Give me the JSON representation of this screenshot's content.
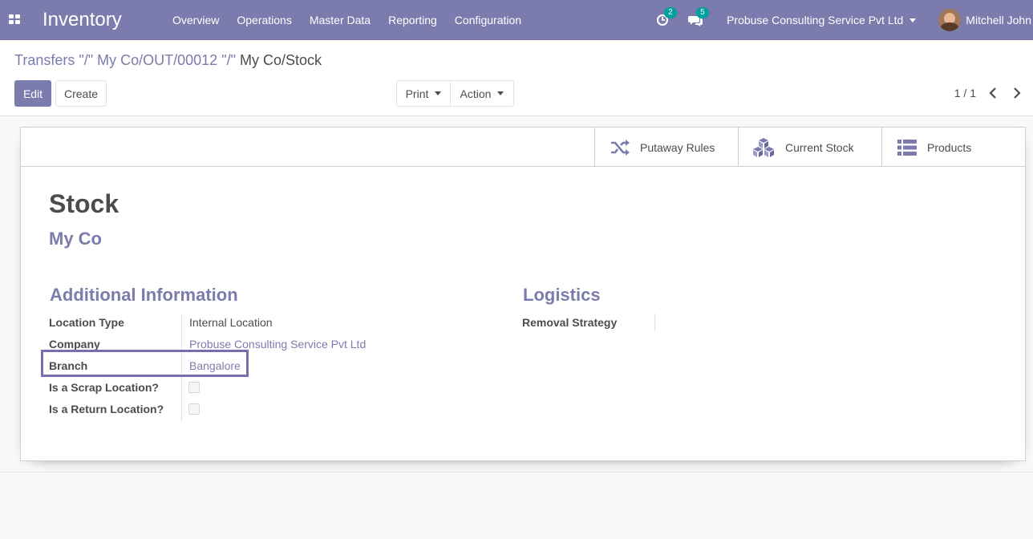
{
  "navbar": {
    "app_name": "Inventory",
    "menu": [
      "Overview",
      "Operations",
      "Master Data",
      "Reporting",
      "Configuration"
    ],
    "activity_count": "2",
    "messages_count": "5",
    "company": "Probuse Consulting Service Pvt Ltd",
    "user": "Mitchell John"
  },
  "control": {
    "breadcrumb_link": "Transfers \"/\" My Co/OUT/00012 \"/\"",
    "breadcrumb_current": "My Co/Stock",
    "edit_label": "Edit",
    "create_label": "Create",
    "print_label": "Print",
    "action_label": "Action",
    "pager": "1 / 1"
  },
  "smart_buttons": {
    "putaway": "Putaway Rules",
    "current_stock": "Current Stock",
    "products": "Products"
  },
  "form": {
    "title": "Stock",
    "parent": "My Co",
    "additional_title": "Additional Information",
    "logistics_title": "Logistics",
    "fields": {
      "location_type_label": "Location Type",
      "location_type_value": "Internal Location",
      "company_label": "Company",
      "company_value": "Probuse Consulting Service Pvt Ltd",
      "branch_label": "Branch",
      "branch_value": "Bangalore",
      "scrap_label": "Is a Scrap Location?",
      "return_label": "Is a Return Location?",
      "removal_label": "Removal Strategy",
      "removal_value": ""
    }
  },
  "colors": {
    "primary": "#7c7bad",
    "highlight_border": "#7c6bb0"
  }
}
